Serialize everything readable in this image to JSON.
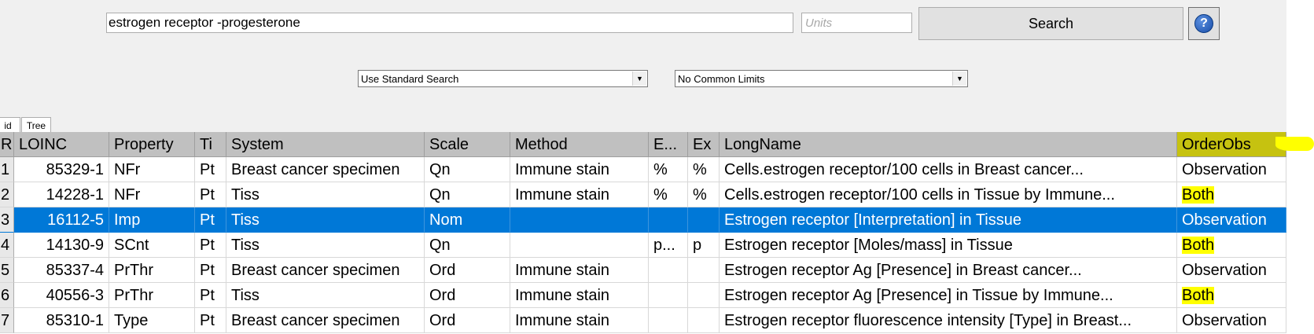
{
  "search": {
    "query": "estrogen receptor -progesterone",
    "units_placeholder": "Units",
    "search_button": "Search",
    "help_icon": "?"
  },
  "options": {
    "search_mode": "Use Standard Search",
    "limits": "No Common Limits",
    "dropdown_arrow": "▼"
  },
  "tabs": [
    {
      "label": "id",
      "active": true
    },
    {
      "label": "Tree",
      "active": false
    }
  ],
  "grid": {
    "columns": [
      "R",
      "LOINC",
      "Property",
      "Ti",
      "System",
      "Scale",
      "Method",
      "E...",
      "Ex",
      "LongName",
      "OrderObs"
    ],
    "rows": [
      {
        "num": "1",
        "loinc": "85329-1",
        "property": "NFr",
        "ti": "Pt",
        "system": "Breast cancer specimen",
        "scale": "Qn",
        "method": "Immune stain",
        "e": "%",
        "ex": "%",
        "longname": "Cells.estrogen receptor/100 cells in Breast cancer...",
        "orderobs": "Observation",
        "highlight": false,
        "selected": false
      },
      {
        "num": "2",
        "loinc": "14228-1",
        "property": "NFr",
        "ti": "Pt",
        "system": "Tiss",
        "scale": "Qn",
        "method": "Immune stain",
        "e": "%",
        "ex": "%",
        "longname": "Cells.estrogen receptor/100 cells in Tissue by Immune...",
        "orderobs": "Both",
        "highlight": true,
        "selected": false
      },
      {
        "num": "3",
        "loinc": "16112-5",
        "property": "Imp",
        "ti": "Pt",
        "system": "Tiss",
        "scale": "Nom",
        "method": "",
        "e": "",
        "ex": "",
        "longname": "Estrogen receptor [Interpretation] in Tissue",
        "orderobs": "Observation",
        "highlight": false,
        "selected": true
      },
      {
        "num": "4",
        "loinc": "14130-9",
        "property": "SCnt",
        "ti": "Pt",
        "system": "Tiss",
        "scale": "Qn",
        "method": "",
        "e": "p...",
        "ex": "p",
        "longname": "Estrogen receptor [Moles/mass] in Tissue",
        "orderobs": "Both",
        "highlight": true,
        "selected": false
      },
      {
        "num": "5",
        "loinc": "85337-4",
        "property": "PrThr",
        "ti": "Pt",
        "system": "Breast cancer specimen",
        "scale": "Ord",
        "method": "Immune stain",
        "e": "",
        "ex": "",
        "longname": "Estrogen receptor Ag [Presence] in Breast cancer...",
        "orderobs": "Observation",
        "highlight": false,
        "selected": false
      },
      {
        "num": "6",
        "loinc": "40556-3",
        "property": "PrThr",
        "ti": "Pt",
        "system": "Tiss",
        "scale": "Ord",
        "method": "Immune stain",
        "e": "",
        "ex": "",
        "longname": "Estrogen receptor Ag [Presence] in Tissue by Immune...",
        "orderobs": "Both",
        "highlight": true,
        "selected": false
      },
      {
        "num": "7",
        "loinc": "85310-1",
        "property": "Type",
        "ti": "Pt",
        "system": "Breast cancer specimen",
        "scale": "Ord",
        "method": "Immune stain",
        "e": "",
        "ex": "",
        "longname": "Estrogen receptor fluorescence intensity [Type] in Breast...",
        "orderobs": "Observation",
        "highlight": false,
        "selected": false
      }
    ]
  },
  "colors": {
    "selected_row": "#0078d7",
    "highlighter": "#ffff00",
    "header_highlight": "#c6c210"
  }
}
